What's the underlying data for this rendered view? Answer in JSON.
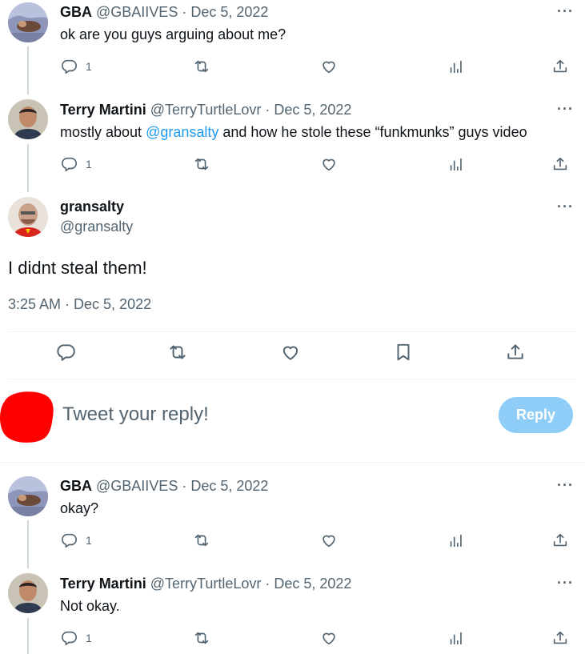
{
  "tweets": [
    {
      "name": "GBA",
      "handle": "@GBAIIVES",
      "date": "· Dec 5, 2022",
      "text": "ok are you guys arguing about me?",
      "reply_count": "1"
    },
    {
      "name": "Terry Martini",
      "handle": "@TerryTurtleLovr",
      "date": "· Dec 5, 2022",
      "text_before": "mostly about ",
      "mention": "@gransalty",
      "text_after": " and how he stole these “funkmunks” guys video",
      "reply_count": "1"
    }
  ],
  "focus": {
    "name": "gransalty",
    "handle": "@gransalty",
    "text": "I didnt steal them!",
    "timestamp": "3:25 AM · Dec 5, 2022"
  },
  "composer": {
    "placeholder": "Tweet your reply!",
    "reply_label": "Reply"
  },
  "replies": [
    {
      "name": "GBA",
      "handle": "@GBAIIVES",
      "date": "· Dec 5, 2022",
      "text": "okay?",
      "reply_count": "1"
    },
    {
      "name": "Terry Martini",
      "handle": "@TerryTurtleLovr",
      "date": "· Dec 5, 2022",
      "text": "Not okay.",
      "reply_count": "1"
    }
  ],
  "more_glyph": "···",
  "icons": [
    "reply-icon",
    "retweet-icon",
    "like-icon",
    "views-icon",
    "share-icon",
    "bookmark-icon",
    "more-icon"
  ],
  "colors": {
    "accent": "#1d9bf0",
    "muted": "#536471",
    "reply_button": "#8ecdf8",
    "redacted_avatar": "#ff0000"
  }
}
